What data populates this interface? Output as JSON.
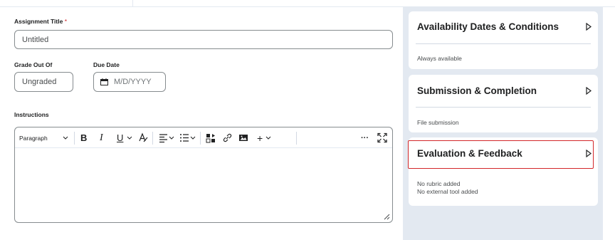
{
  "form": {
    "title_label": "Assignment Title",
    "required_mark": "*",
    "title_value": "Untitled",
    "grade_label": "Grade Out Of",
    "grade_value": "Ungraded",
    "due_label": "Due Date",
    "due_placeholder": "M/D/YYYY",
    "instructions_label": "Instructions"
  },
  "editor": {
    "paragraph_label": "Paragraph",
    "bold": "B",
    "italic": "I",
    "underline": "U",
    "plus": "+",
    "more": "···"
  },
  "panels": [
    {
      "title": "Availability Dates & Conditions",
      "lines": [
        "Always available"
      ]
    },
    {
      "title": "Submission & Completion",
      "lines": [
        "File submission"
      ]
    },
    {
      "title": "Evaluation & Feedback",
      "lines": [
        "No rubric added",
        "No external tool added"
      ]
    }
  ],
  "colors": {
    "highlight": "#d3272a",
    "side_background": "#e3e9f1",
    "required": "#cd2026"
  }
}
